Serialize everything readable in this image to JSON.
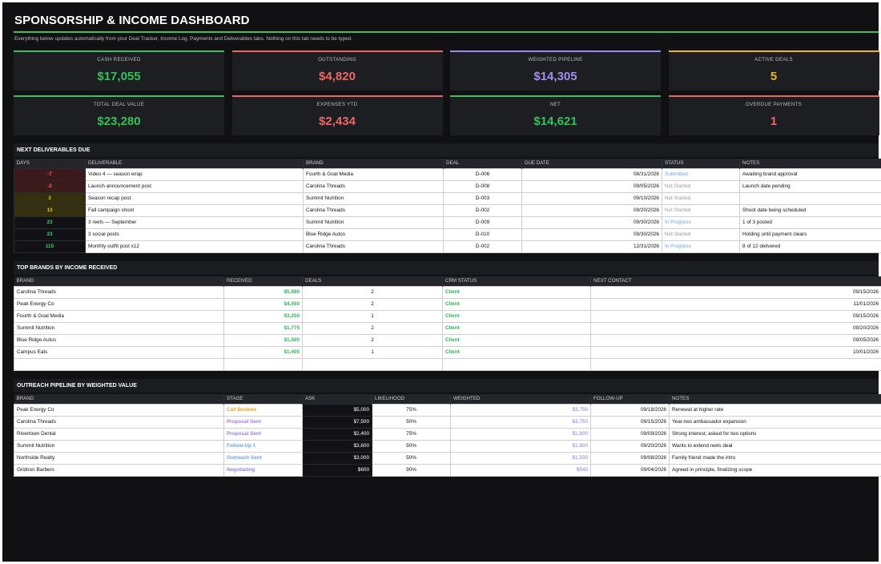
{
  "header": {
    "title": "SPONSORSHIP & INCOME DASHBOARD",
    "subtitle": "Everything below updates automatically from your Deal Tracker, Income Log, Payments and Deliverables tabs. Nothing on this tab needs to be typed."
  },
  "kpis": [
    {
      "label": "CASH RECEIVED",
      "value": "$17,055",
      "color": "#35c15a",
      "accent": "#3fbf60"
    },
    {
      "label": "OUTSTANDING",
      "value": "$4,820",
      "color": "#ee6666",
      "accent": "#e66565"
    },
    {
      "label": "WEIGHTED PIPELINE",
      "value": "$14,305",
      "color": "#a58cf0",
      "accent": "#9d86ee"
    },
    {
      "label": "ACTIVE DEALS",
      "value": "5",
      "color": "#f0b429",
      "accent": "#f0b429"
    },
    {
      "label": "TOTAL DEAL VALUE",
      "value": "$23,280",
      "color": "#35c15a",
      "accent": "#3fbf60"
    },
    {
      "label": "EXPENSES YTD",
      "value": "$2,434",
      "color": "#ee6666",
      "accent": "#e66565"
    },
    {
      "label": "NET",
      "value": "$14,621",
      "color": "#35c15a",
      "accent": "#3fbf60"
    },
    {
      "label": "OVERDUE PAYMENTS",
      "value": "1",
      "color": "#ee6666",
      "accent": "#e66565"
    }
  ],
  "deliverables": {
    "heading": "NEXT DELIVERABLES DUE",
    "columns": [
      "DAYS",
      "DELIVERABLE",
      "BRAND",
      "DEAL",
      "DUE DATE",
      "STATUS",
      "NOTES"
    ],
    "rows": [
      {
        "days": "-7",
        "days_bg": "#3a1a1a",
        "days_color": "#ff6b6b",
        "deliverable": "Video 4 — season wrap",
        "brand": "Fourth & Goal Media",
        "deal": "D-006",
        "due": "08/31/2026",
        "status": "Submitted",
        "status_class": "st-blue",
        "notes": "Awaiting brand approval"
      },
      {
        "days": "-2",
        "days_bg": "#3a1a1a",
        "days_color": "#ff6b6b",
        "deliverable": "Launch announcement post",
        "brand": "Carolina Threads",
        "deal": "D-008",
        "due": "09/05/2026",
        "status": "Not Started",
        "status_class": "st-gray",
        "notes": "Launch date pending"
      },
      {
        "days": "3",
        "days_bg": "#34300f",
        "days_color": "#f0c419",
        "deliverable": "Season recap post",
        "brand": "Summit Nutrition",
        "deal": "D-003",
        "due": "09/10/2026",
        "status": "Not Started",
        "status_class": "st-gray",
        "notes": ""
      },
      {
        "days": "13",
        "days_bg": "#34300f",
        "days_color": "#f0c419",
        "deliverable": "Fall campaign shoot",
        "brand": "Carolina Threads",
        "deal": "D-002",
        "due": "09/20/2026",
        "status": "Not Started",
        "status_class": "st-gray",
        "notes": "Shoot date being scheduled"
      },
      {
        "days": "23",
        "days_bg": "#121216",
        "days_color": "#3fcf6a",
        "deliverable": "3 reels — September",
        "brand": "Summit Nutrition",
        "deal": "D-009",
        "due": "09/30/2026",
        "status": "In Progress",
        "status_class": "st-blue",
        "notes": "1 of 3 posted"
      },
      {
        "days": "23",
        "days_bg": "#121216",
        "days_color": "#3fcf6a",
        "deliverable": "3 social posts",
        "brand": "Blue Ridge Autos",
        "deal": "D-010",
        "due": "09/30/2026",
        "status": "Not Started",
        "status_class": "st-gray",
        "notes": "Holding until payment clears"
      },
      {
        "days": "115",
        "days_bg": "#121216",
        "days_color": "#3fcf6a",
        "deliverable": "Monthly outfit post x12",
        "brand": "Carolina Threads",
        "deal": "D-002",
        "due": "12/31/2026",
        "status": "In Progress",
        "status_class": "st-blue",
        "notes": "8 of 12 delivered"
      }
    ]
  },
  "brands": {
    "heading": "TOP BRANDS BY INCOME RECEIVED",
    "columns": [
      "BRAND",
      "RECEIVED",
      "DEALS",
      "CRM STATUS",
      "NEXT CONTACT"
    ],
    "rows": [
      {
        "brand": "Carolina Threads",
        "received": "$5,980",
        "deals": "2",
        "crm": "Client",
        "next": "09/15/2026"
      },
      {
        "brand": "Peak Energy Co",
        "received": "$4,550",
        "deals": "2",
        "crm": "Client",
        "next": "11/01/2026"
      },
      {
        "brand": "Fourth & Goal Media",
        "received": "$3,250",
        "deals": "1",
        "crm": "Client",
        "next": "09/15/2026"
      },
      {
        "brand": "Summit Nutrition",
        "received": "$1,775",
        "deals": "2",
        "crm": "Client",
        "next": "09/20/2026"
      },
      {
        "brand": "Blue Ridge Autos",
        "received": "$1,500",
        "deals": "2",
        "crm": "Client",
        "next": "09/05/2026"
      },
      {
        "brand": "Campus Eats",
        "received": "$1,405",
        "deals": "1",
        "crm": "Client",
        "next": "10/01/2026"
      },
      {
        "brand": "",
        "received": "",
        "deals": "",
        "crm": "",
        "next": ""
      }
    ]
  },
  "pipeline": {
    "heading": "OUTREACH PIPELINE BY WEIGHTED VALUE",
    "columns": [
      "BRAND",
      "STAGE",
      "ASK",
      "LIKELIHOOD",
      "WEIGHTED",
      "FOLLOW-UP",
      "NOTES"
    ],
    "rows": [
      {
        "brand": "Peak Energy Co",
        "stage": "Call Booked",
        "stage_class": "st-gold",
        "ask": "$5,000",
        "likelihood": "75%",
        "weighted": "$3,750",
        "followup": "09/18/2026",
        "notes": "Renewal at higher rate"
      },
      {
        "brand": "Carolina Threads",
        "stage": "Proposal Sent",
        "stage_class": "st-purple",
        "ask": "$7,500",
        "likelihood": "50%",
        "weighted": "$3,750",
        "followup": "09/15/2026",
        "notes": "Year-two ambassador expansion"
      },
      {
        "brand": "Rivertown Dental",
        "stage": "Proposal Sent",
        "stage_class": "st-purple",
        "ask": "$2,400",
        "likelihood": "75%",
        "weighted": "$1,800",
        "followup": "09/09/2026",
        "notes": "Strong interest; asked for two options"
      },
      {
        "brand": "Summit Nutrition",
        "stage": "Follow-Up 1",
        "stage_class": "st-blue",
        "ask": "$3,600",
        "likelihood": "50%",
        "weighted": "$1,800",
        "followup": "09/20/2026",
        "notes": "Wants to extend reels deal"
      },
      {
        "brand": "Northside Realty",
        "stage": "Outreach Sent",
        "stage_class": "st-blue",
        "ask": "$3,000",
        "likelihood": "50%",
        "weighted": "$1,500",
        "followup": "09/08/2026",
        "notes": "Family friend made the intro"
      },
      {
        "brand": "Gridiron Barbers",
        "stage": "Negotiating",
        "stage_class": "st-purple",
        "ask": "$600",
        "likelihood": "90%",
        "weighted": "$540",
        "followup": "09/04/2026",
        "notes": "Agreed in principle, finalizing scope"
      }
    ]
  }
}
